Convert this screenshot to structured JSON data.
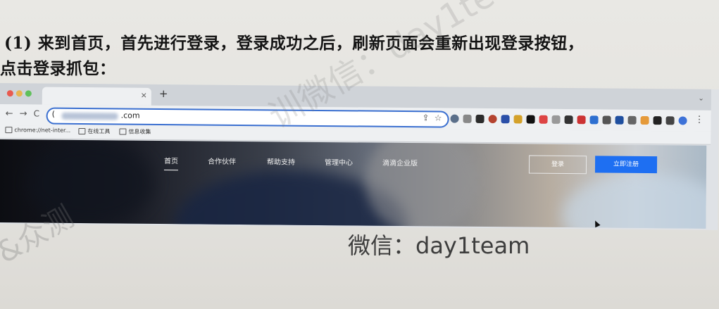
{
  "document": {
    "line1": "(1)  来到首页，首先进行登录，登录成功之后，刷新页面会重新出现登录按钮，",
    "line2": "点击登录抓包："
  },
  "browser": {
    "tab_close": "×",
    "new_tab": "+",
    "address": {
      "prefix": "(",
      "tld": ".com"
    },
    "bookmarks": [
      {
        "label": "chrome://net-inter..."
      },
      {
        "label": "在线工具"
      },
      {
        "label": "信息收集"
      }
    ],
    "colors": {
      "omnibox_border": "#3a6fd0",
      "close": "#e85a4f",
      "minimize": "#e8b54f",
      "maximize": "#5fc05a"
    }
  },
  "site": {
    "nav": [
      {
        "label": "首页",
        "active": true
      },
      {
        "label": "合作伙伴"
      },
      {
        "label": "帮助支持"
      },
      {
        "label": "管理中心"
      },
      {
        "label": "滴滴企业版"
      }
    ],
    "login_label": "登录",
    "register_label": "立即注册",
    "accent_color": "#1e6ff2"
  },
  "caption": "微信：day1team",
  "watermarks": {
    "top": "训微信：day1te",
    "bottom": "&众测"
  }
}
